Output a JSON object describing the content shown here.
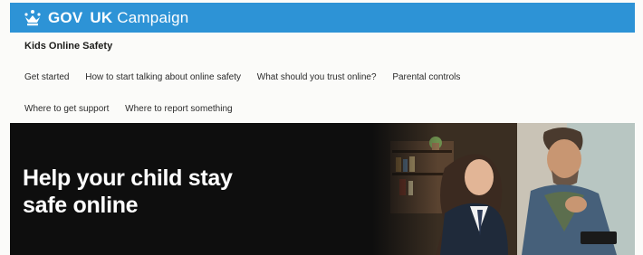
{
  "brand": {
    "crown_icon": "crown-icon",
    "gov_label": "GOV",
    "campaign_prefix": "UK",
    "campaign_label": "Campaign",
    "color": "#2d93d6"
  },
  "service_name": "Kids Online Safety",
  "nav": {
    "row1": [
      "Get started",
      "How to start talking about online safety",
      "What should you trust online?",
      "Parental controls"
    ],
    "row2": [
      "Where to get support",
      "Where to report something"
    ]
  },
  "hero": {
    "title_line1": "Help your child stay",
    "title_line2": "safe online",
    "background": "#0e0e0e"
  }
}
